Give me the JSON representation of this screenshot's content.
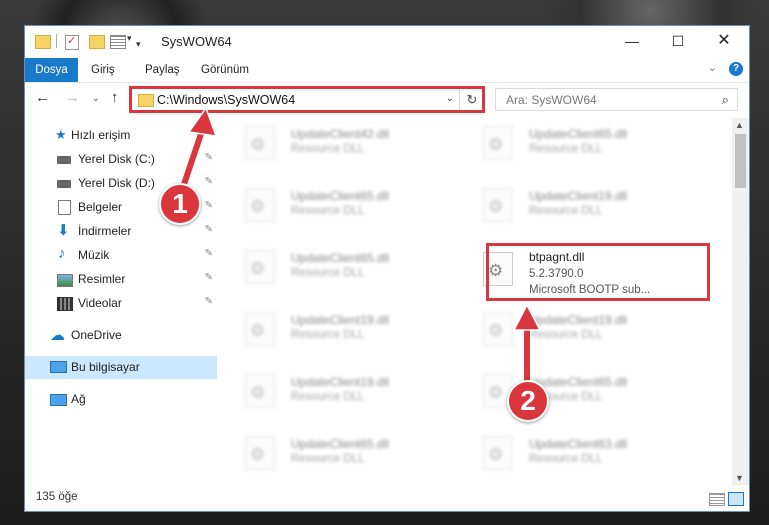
{
  "window": {
    "title": "SysWOW64",
    "minimize_glyph": "—",
    "maximize_glyph": "☐",
    "close_glyph": "✕"
  },
  "ribbon": {
    "tabs": [
      "Dosya",
      "Giriş",
      "Paylaş",
      "Görünüm"
    ],
    "expand_glyph": "⌄",
    "help_glyph": "?"
  },
  "nav": {
    "back_glyph": "←",
    "forward_glyph": "→",
    "recent_glyph": "⌄",
    "up_glyph": "↑"
  },
  "address": {
    "path": "C:\\Windows\\SysWOW64",
    "dropdown_glyph": "⌄",
    "refresh_glyph": "↻"
  },
  "search": {
    "placeholder": "Ara: SysWOW64",
    "icon_glyph": "⌕"
  },
  "sidebar": {
    "quick_access": "Hızlı erişim",
    "items": [
      {
        "label": "Yerel Disk (C:)",
        "icon": "drive-icon"
      },
      {
        "label": "Yerel Disk (D:)",
        "icon": "drive-icon"
      },
      {
        "label": "Belgeler",
        "icon": "documents-icon"
      },
      {
        "label": "İndirmeler",
        "icon": "downloads-icon"
      },
      {
        "label": "Müzik",
        "icon": "music-icon"
      },
      {
        "label": "Resimler",
        "icon": "pictures-icon"
      },
      {
        "label": "Videolar",
        "icon": "videos-icon"
      }
    ],
    "onedrive": "OneDrive",
    "this_pc": "Bu bilgisayar",
    "network": "Ağ",
    "pin_glyph": "📌"
  },
  "files": {
    "left_column": [
      {
        "name": "UpdateClient42.dll",
        "desc": "Resource DLL"
      },
      {
        "name": "UpdateClient65.dll",
        "desc": "Resource DLL"
      },
      {
        "name": "UpdateClient65.dll",
        "desc": "Resource DLL"
      },
      {
        "name": "UpdateClient19.dll",
        "desc": "Resource DLL"
      },
      {
        "name": "UpdateClient19.dll",
        "desc": "Resource DLL"
      },
      {
        "name": "UpdateClient65.dll",
        "desc": "Resource DLL"
      }
    ],
    "right_column": [
      {
        "name": "UpdateClient65.dll",
        "desc": "Resource DLL"
      },
      {
        "name": "UpdateClient19.dll",
        "desc": "Resource DLL"
      },
      {
        "name": "UpdateClient19.dll",
        "desc": "Resource DLL"
      },
      {
        "name": "UpdateClient65.dll",
        "desc": "Resource DLL"
      },
      {
        "name": "UpdateClient63.dll",
        "desc": "Resource DLL"
      }
    ],
    "highlighted": {
      "name": "btpagnt.dll",
      "version": "5.2.3790.0",
      "desc": "Microsoft BOOTP sub..."
    }
  },
  "status": {
    "count": "135 öğe"
  },
  "callouts": {
    "step1": "1",
    "step2": "2"
  },
  "colors": {
    "accent": "#1979ca",
    "highlight": "#d9363e",
    "selected": "#cce8ff"
  }
}
